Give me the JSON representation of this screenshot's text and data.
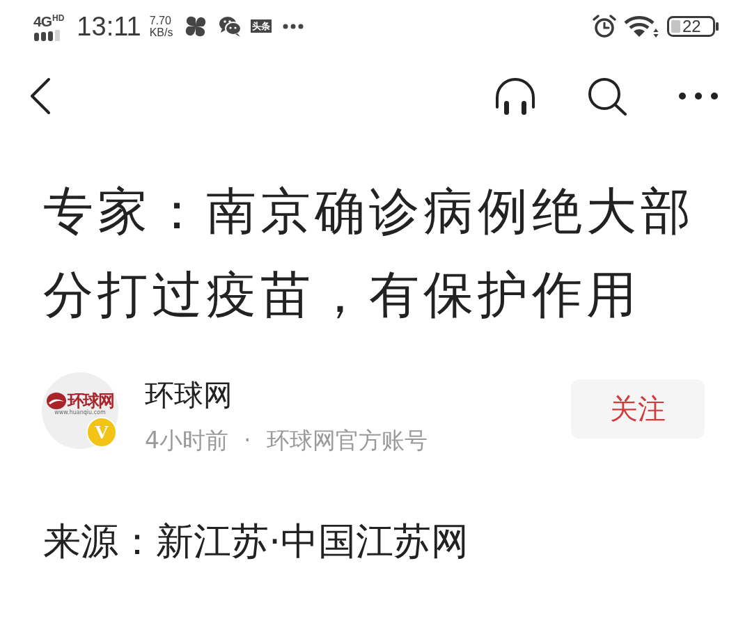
{
  "status_bar": {
    "network": "4G",
    "network_badge": "HD",
    "time": "13:11",
    "speed_value": "7.70",
    "speed_unit": "KB/s",
    "notification_icons": [
      {
        "kind": "pinwheel"
      },
      {
        "kind": "chat"
      },
      {
        "kind": "text_badge",
        "label": "头条"
      }
    ],
    "battery_text": "22"
  },
  "article": {
    "title": "专家：南京确诊病例绝大部分打过疫苗，有保护作用",
    "author": {
      "logo_text": "环球网",
      "logo_url": "www.huanqiu.com",
      "badge": "V",
      "name": "环球网",
      "time": "4小时前",
      "separator": "·",
      "account_type": "环球网官方账号",
      "follow_label": "关注"
    },
    "source": "来源：新江苏·中国江苏网"
  }
}
